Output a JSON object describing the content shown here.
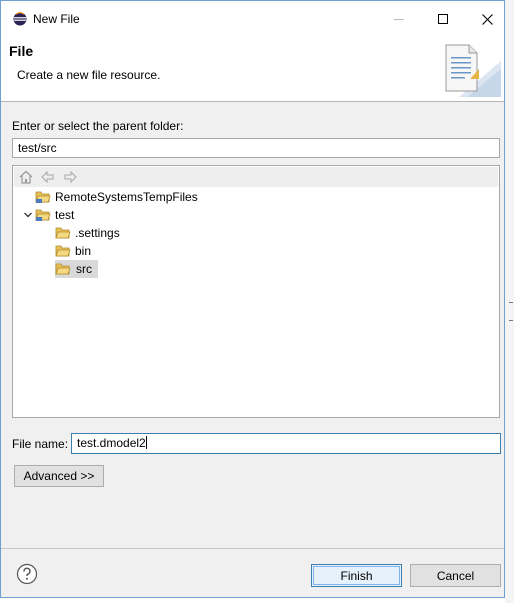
{
  "window": {
    "title": "New File",
    "controls": {
      "minimize": "minimize-icon",
      "maximize": "maximize-icon",
      "close": "close-icon"
    }
  },
  "header": {
    "title": "File",
    "description": "Create a new file resource."
  },
  "parent_folder": {
    "label": "Enter or select the parent folder:",
    "value": "test/src"
  },
  "tree": {
    "toolbar": [
      "home-icon",
      "back-arrow-icon",
      "forward-arrow-icon"
    ],
    "items": [
      {
        "label": "RemoteSystemsTempFiles",
        "expanded": false,
        "selected": false
      },
      {
        "label": "test",
        "expanded": true,
        "selected": false
      },
      {
        "label": ".settings",
        "expanded": false,
        "selected": false
      },
      {
        "label": "bin",
        "expanded": false,
        "selected": false
      },
      {
        "label": "src",
        "expanded": false,
        "selected": true
      }
    ]
  },
  "file_name": {
    "label": "File name:",
    "value": "test.dmodel2"
  },
  "buttons": {
    "advanced": "Advanced >>",
    "finish": "Finish",
    "cancel": "Cancel"
  },
  "colors": {
    "accent": "#3c7fb1",
    "folder": "#e8c15a",
    "selection": "#d9d9d9"
  }
}
